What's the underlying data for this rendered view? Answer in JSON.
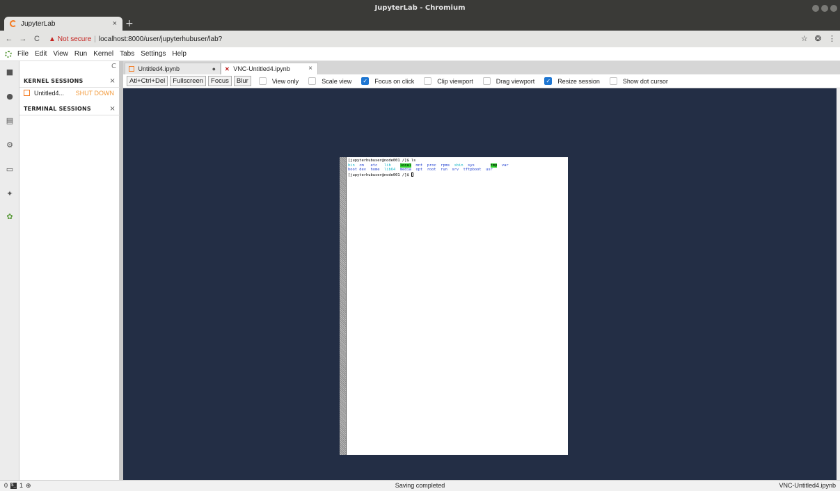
{
  "window": {
    "title": "JupyterLab - Chromium"
  },
  "browser": {
    "tab_label": "JupyterLab",
    "tab_close": "×",
    "new_tab": "+",
    "back": "←",
    "forward": "→",
    "reload": "C",
    "warning_glyph": "▲",
    "not_secure": "Not secure",
    "separator": "|",
    "url": "localhost:8000/user/jupyterhubuser/lab?",
    "star": "☆",
    "profile": "❂",
    "menu": "⋮"
  },
  "menu": {
    "items": [
      "File",
      "Edit",
      "View",
      "Run",
      "Kernel",
      "Tabs",
      "Settings",
      "Help"
    ]
  },
  "sidebar": {
    "refresh": "C",
    "kernel_header": "KERNEL SESSIONS",
    "terminal_header": "TERMINAL SESSIONS",
    "close": "×",
    "session_name": "Untitled4...",
    "shutdown_label": "SHUT DOWN"
  },
  "doc_tabs": [
    {
      "label": "Untitled4.ipynb",
      "marker": "●"
    },
    {
      "label": "VNC-Untitled4.ipynb",
      "marker": "×"
    }
  ],
  "vnc_toolbar": {
    "buttons": [
      "Atl+Ctrl+Del",
      "Fullscreen",
      "Focus",
      "Blur"
    ],
    "options": [
      {
        "label": "View only",
        "checked": false
      },
      {
        "label": "Scale view",
        "checked": false
      },
      {
        "label": "Focus on click",
        "checked": true
      },
      {
        "label": "Clip viewport",
        "checked": false
      },
      {
        "label": "Drag viewport",
        "checked": false
      },
      {
        "label": "Resize session",
        "checked": true
      },
      {
        "label": "Show dot cursor",
        "checked": false
      }
    ]
  },
  "terminal": {
    "prompt1": "[jupyterhubuser@node001 /]$ ls",
    "row1": [
      "bin",
      "cm",
      "etc",
      "lib",
      "local",
      "mnt",
      "proc",
      "rpms",
      "sbin",
      "sys",
      "tmp",
      "var"
    ],
    "row2": [
      "boot",
      "dev",
      "home",
      "lib64",
      "media",
      "opt",
      "root",
      "run",
      "srv",
      "tftpboot",
      "usr"
    ],
    "prompt2": "[jupyterhubuser@node001 /]$ "
  },
  "statusbar": {
    "count_left": "0",
    "terminal_glyph": "$_",
    "count_right": "1",
    "kernel_glyph": "⊕",
    "status": "Saving completed",
    "current_doc": "VNC-Untitled4.ipynb"
  },
  "colors": {
    "vnc_background": "#232e45",
    "shutdown": "#f39a3a",
    "checkbox_on": "#1e76d2"
  }
}
